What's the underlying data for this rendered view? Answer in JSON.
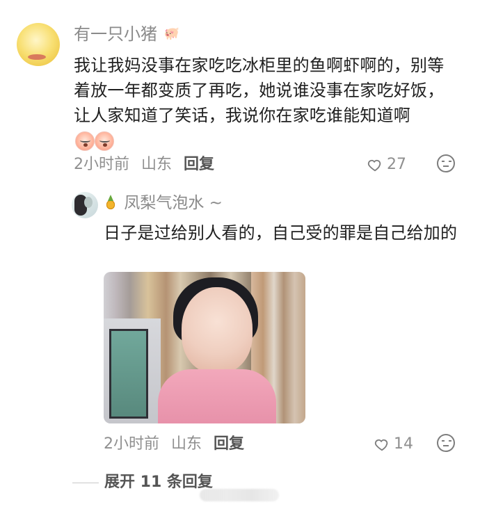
{
  "comment": {
    "username": "有一只小猪",
    "username_icon": "pig-icon",
    "text": "我让我妈没事在家吃吃冰柜里的鱼啊虾啊的，别等着放一年都变质了再吃，她说谁没事在家吃好饭，让人家知道了笑话，我说你在家吃谁能知道啊",
    "reaction_icons": [
      "cry-laugh-icon",
      "cry-laugh-icon"
    ],
    "time": "2小时前",
    "location": "山东",
    "reply_label": "回复",
    "likes": "27",
    "more_icon": "reaction-face-icon"
  },
  "reply": {
    "username": "凤梨气泡水 ~",
    "username_icon": "pineapple-icon",
    "text": "日子是过给别人看的，自己受的罪是自己给加的",
    "image_icon": "meme-photo",
    "time": "2小时前",
    "location": "山东",
    "reply_label": "回复",
    "likes": "14",
    "more_icon": "reaction-face-icon"
  },
  "expand_replies": {
    "label": "展开 11 条回复"
  },
  "colors": {
    "meta_gray": "#8f8f8f",
    "text_dark": "#1f1f1f",
    "heart_gray": "#7d7d7d"
  }
}
